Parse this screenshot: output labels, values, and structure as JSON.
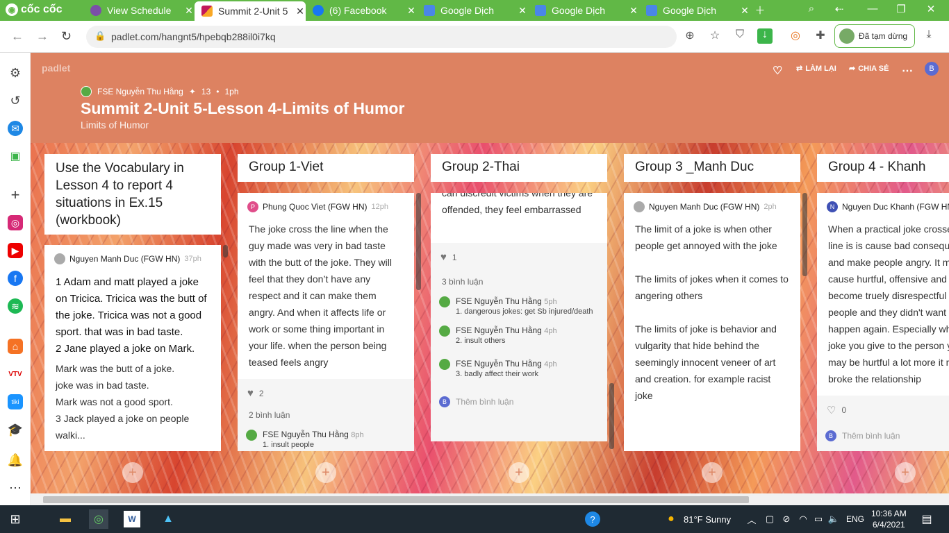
{
  "browser": {
    "brand": "cốc cốc",
    "tabs": [
      {
        "title": "View Schedule",
        "active": false,
        "color": "#7b4fa8"
      },
      {
        "title": "Summit 2-Unit 5",
        "active": true,
        "color": "#c2185b"
      },
      {
        "title": "(6) Facebook",
        "active": false,
        "color": "#1877f2"
      },
      {
        "title": "Google Dịch",
        "active": false,
        "color": "#4a86e8"
      },
      {
        "title": "Google Dịch",
        "active": false,
        "color": "#4a86e8"
      },
      {
        "title": "Google Dịch",
        "active": false,
        "color": "#4a86e8"
      }
    ],
    "url": "padlet.com/hangnt5/hpebqb288il0i7kq",
    "profile_status": "Đã tạm dừng"
  },
  "padlet": {
    "logo": "padlet",
    "actions": {
      "remake": "LÀM LẠI",
      "share": "CHIA SẺ"
    },
    "user_initial": "B",
    "owner": "FSE Nguyễn Thu Hằng",
    "points": "13",
    "time": "1ph",
    "title": "Summit 2-Unit 5-Lesson 4-Limits of Humor",
    "subtitle": "Limits of Humor"
  },
  "columns": [
    {
      "title": "Use the Vocabulary in Lesson 4 to report 4 situations in Ex.15 (workbook)",
      "card": {
        "author": "Nguyen Manh Duc (FGW HN)",
        "time": "37ph",
        "bold_text": "  1 Adam and matt played a joke on Tricica. Tricica was the butt of the joke. Tricica was not a good sport. that was in bad taste.\n2 Jane played a joke on Mark.",
        "text": "Mark was the butt of a joke.\njoke was in bad taste.\nMark was not a good sport.\n3 Jack played a joke on people\nwalki..."
      }
    },
    {
      "title": "Group 1-Viet",
      "card": {
        "author": "Phung Quoc Viet (FGW HN)",
        "time": "12ph",
        "initial": "P",
        "text": "The joke cross the line when the guy made was very in bad taste with the butt of the joke. They will feel that they don’t have any respect and it can make them angry. And when it affects life or work or some thing important in your life. when the person being teased feels angry",
        "likes": "2",
        "comments_count": "2 bình luận",
        "comments": [
          {
            "author": "FSE Nguyễn Thu Hằng",
            "time": "8ph",
            "text": "1. insult people"
          }
        ]
      }
    },
    {
      "title": "Group 2-Thai",
      "card": {
        "text": "can discredit victims when they are offended, they feel embarrassed",
        "likes": "1",
        "comments_count": "3 bình luận",
        "comments": [
          {
            "author": "FSE Nguyễn Thu Hằng",
            "time": "5ph",
            "text": "1. dangerous jokes: get Sb injured/death"
          },
          {
            "author": "FSE Nguyễn Thu Hằng",
            "time": "4ph",
            "text": "2. insult others"
          },
          {
            "author": "FSE Nguyễn Thu Hằng",
            "time": "4ph",
            "text": "3. badly affect their work"
          }
        ],
        "add_comment": "Thêm bình luận",
        "initial": "B"
      }
    },
    {
      "title": "Group 3 _Manh Duc",
      "card": {
        "author": "Nguyen Manh Duc (FGW HN)",
        "time": "2ph",
        "text": "The limit of a joke is when other people get annoyed with the joke\n\nThe limits of jokes when it comes to angering others\n\nThe limits of joke is behavior and vulgarity that hide behind the seemingly innocent veneer of art and creation. for example racist joke"
      }
    },
    {
      "title": "Group 4  - Khanh",
      "card": {
        "author": "Nguyen Duc Khanh (FGW HN)",
        "initial": "N",
        "text": "When a practical joke crosses the line is is cause bad consequences and make people angry. It may cause hurtful, offensive and it is become truely disrespectful to other people and they didn't want it to happen again. Especially when the joke you give to the person you it may be hurtful a lot more it may broke the relationship",
        "likes": "0",
        "add_comment": "Thêm bình luận",
        "initial2": "B"
      }
    }
  ],
  "taskbar": {
    "weather": "81°F  Sunny",
    "lang": "ENG",
    "time": "10:36 AM",
    "date": "6/4/2021"
  }
}
